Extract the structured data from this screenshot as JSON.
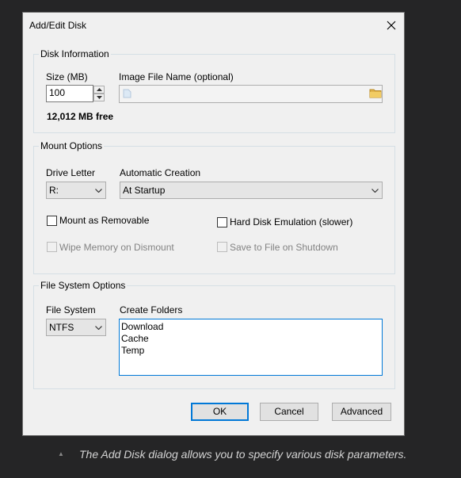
{
  "dialog": {
    "title": "Add/Edit Disk",
    "close_icon": "close-icon"
  },
  "disk_info": {
    "group_title": "Disk Information",
    "size_label": "Size (MB)",
    "size_value": "100",
    "image_label": "Image File Name (optional)",
    "image_value": "",
    "free_space": "12,012 MB free"
  },
  "mount": {
    "group_title": "Mount Options",
    "drive_letter_label": "Drive Letter",
    "drive_letter_value": "R:",
    "auto_creation_label": "Automatic Creation",
    "auto_creation_value": "At Startup",
    "mount_removable_label": "Mount as Removable",
    "mount_removable_checked": false,
    "hdd_emulation_label": "Hard Disk Emulation (slower)",
    "hdd_emulation_checked": false,
    "wipe_memory_label": "Wipe Memory on Dismount",
    "save_to_file_label": "Save to File on Shutdown"
  },
  "fs": {
    "group_title": "File System Options",
    "fs_label": "File System",
    "fs_value": "NTFS",
    "folders_label": "Create Folders",
    "folders": [
      "Download",
      "Cache",
      "Temp"
    ]
  },
  "buttons": {
    "ok": "OK",
    "cancel": "Cancel",
    "advanced": "Advanced"
  },
  "caption": "The Add Disk dialog allows you to specify various disk parameters.",
  "colors": {
    "dialog_bg": "#f0f0f0",
    "accent": "#0078d7",
    "page_bg": "#252526"
  }
}
